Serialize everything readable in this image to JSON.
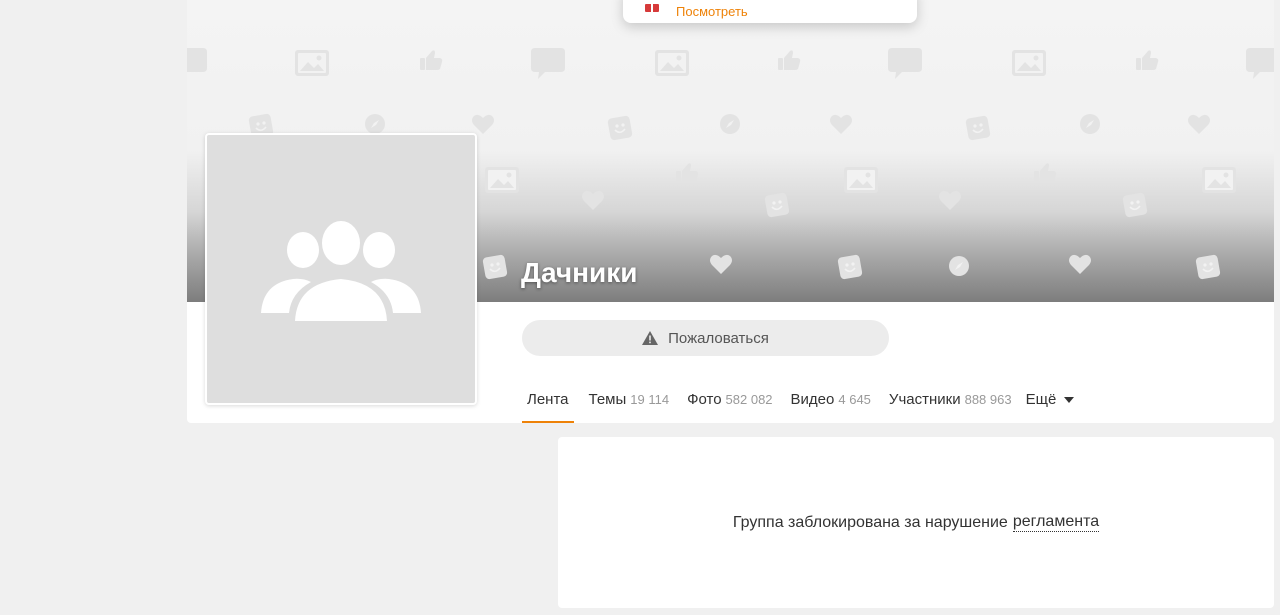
{
  "popup": {
    "label": "Посмотреть",
    "icon": "gift-icon"
  },
  "group": {
    "name": "Дачники",
    "avatar_icon": "group-placeholder-icon"
  },
  "actions": {
    "complain_label": "Пожаловаться",
    "complain_icon": "warning-icon"
  },
  "tabs": [
    {
      "label": "Лента",
      "count": "",
      "active": true
    },
    {
      "label": "Темы",
      "count": "19 114"
    },
    {
      "label": "Фото",
      "count": "582 082"
    },
    {
      "label": "Видео",
      "count": "4 645"
    },
    {
      "label": "Участники",
      "count": "888 963"
    },
    {
      "label": "Ещё",
      "count": ""
    }
  ],
  "notice": {
    "text": "Группа заблокирована за нарушение",
    "link": "регламента"
  },
  "colors": {
    "accent": "#ee8208",
    "page_background": "#f0f0f0"
  }
}
